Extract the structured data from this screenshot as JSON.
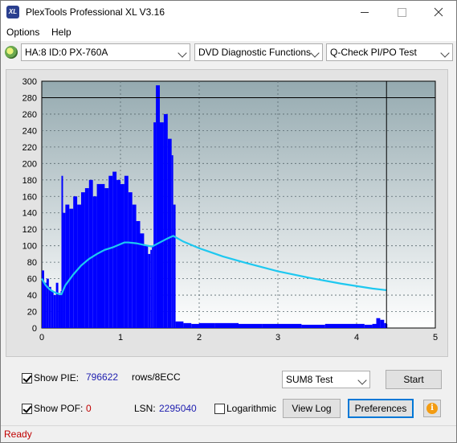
{
  "window": {
    "title": "PlexTools Professional XL V3.16",
    "icon_text": "XL",
    "controls": [
      "minimize",
      "maximize",
      "close"
    ]
  },
  "menu": {
    "options": "Options",
    "help": "Help"
  },
  "toolbar": {
    "drive": "HA:8 ID:0  PX-760A",
    "function": "DVD Diagnostic Functions",
    "test": "Q-Check PI/PO Test"
  },
  "chart_data": {
    "type": "area",
    "title": "",
    "xlabel": "",
    "ylabel": "",
    "xlim": [
      0,
      5
    ],
    "ylim": [
      0,
      300
    ],
    "x_ticks": [
      0,
      1,
      2,
      3,
      4,
      5
    ],
    "y_ticks": [
      0,
      20,
      40,
      60,
      80,
      100,
      120,
      140,
      160,
      180,
      200,
      220,
      240,
      260,
      280,
      300
    ],
    "threshold_line": 280,
    "end_marker_x": 4.38,
    "colors": {
      "pie_bars": "#0000ff",
      "speed_curve": "#1ec8f0",
      "plot_bg_top": "#95aab0",
      "plot_bg_bottom": "#ffffff"
    },
    "series": [
      {
        "kind": "bars",
        "x": [
          0.0,
          0.03,
          0.06,
          0.09,
          0.12,
          0.15,
          0.18,
          0.21,
          0.24,
          0.25,
          0.27,
          0.3,
          0.35,
          0.4,
          0.45,
          0.5,
          0.55,
          0.6,
          0.65,
          0.7,
          0.75,
          0.8,
          0.85,
          0.9,
          0.95,
          1.0,
          1.05,
          1.1,
          1.15,
          1.2,
          1.25,
          1.3,
          1.35,
          1.38,
          1.4,
          1.42,
          1.45,
          1.5,
          1.55,
          1.6,
          1.65,
          1.67,
          1.7,
          1.8,
          1.9,
          2.0,
          2.2,
          2.5,
          2.8,
          3.0,
          3.3,
          3.6,
          4.0,
          4.1,
          4.2,
          4.25,
          4.3,
          4.35,
          4.38
        ],
        "values": [
          70,
          55,
          60,
          50,
          45,
          40,
          55,
          40,
          45,
          185,
          140,
          150,
          145,
          160,
          150,
          165,
          170,
          180,
          160,
          175,
          175,
          170,
          185,
          190,
          180,
          175,
          185,
          165,
          150,
          130,
          115,
          100,
          90,
          95,
          100,
          250,
          295,
          250,
          260,
          230,
          210,
          150,
          8,
          6,
          5,
          6,
          6,
          5,
          5,
          5,
          4,
          5,
          5,
          4,
          5,
          12,
          10,
          6,
          5
        ]
      },
      {
        "kind": "line",
        "x": [
          0.0,
          0.05,
          0.1,
          0.15,
          0.2,
          0.25,
          0.3,
          0.4,
          0.5,
          0.6,
          0.7,
          0.8,
          0.9,
          1.0,
          1.05,
          1.1,
          1.2,
          1.3,
          1.35,
          1.4,
          1.5,
          1.6,
          1.67,
          1.8,
          2.0,
          2.3,
          2.6,
          3.0,
          3.4,
          3.8,
          4.2,
          4.38
        ],
        "values": [
          60,
          52,
          47,
          44,
          42,
          41,
          52,
          65,
          76,
          84,
          90,
          95,
          98,
          102,
          104,
          104,
          103,
          101,
          100,
          99,
          104,
          109,
          112,
          105,
          97,
          87,
          79,
          69,
          61,
          54,
          48,
          46
        ]
      }
    ]
  },
  "controls": {
    "show_pie_label": "Show PIE:",
    "pie_value": "796622",
    "pie_unit": "rows/8ECC",
    "show_pof_label": "Show POF:",
    "pof_value": "0",
    "lsn_label": "LSN:",
    "lsn_value": "2295040",
    "logarithmic_label": "Logarithmic",
    "test_mode": "SUM8 Test",
    "start": "Start",
    "view_log": "View Log",
    "preferences": "Preferences",
    "info": "i"
  },
  "status": {
    "text": "Ready"
  }
}
